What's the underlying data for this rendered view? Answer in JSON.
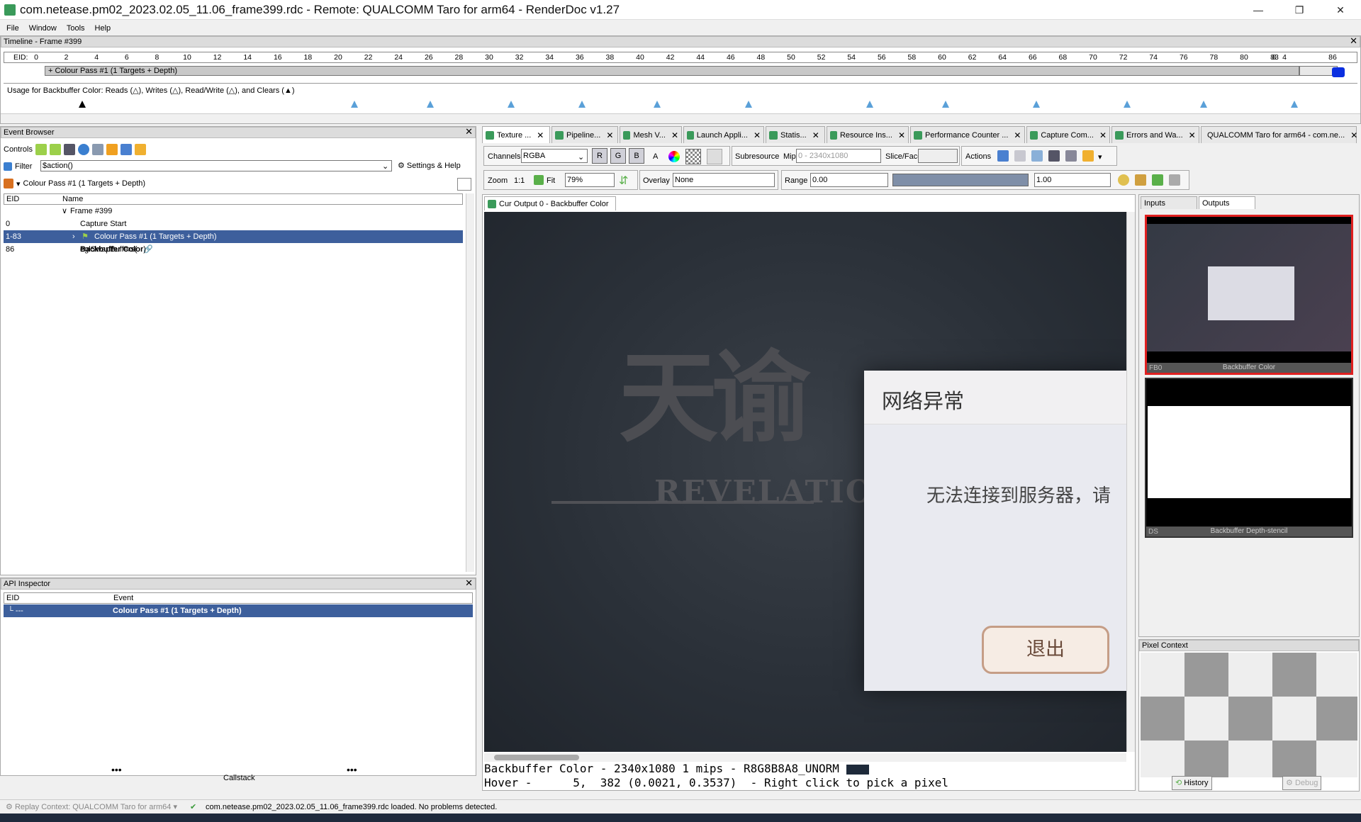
{
  "window": {
    "title": "com.netease.pm02_2023.02.05_11.06_frame399.rdc - Remote: QUALCOMM Taro for arm64 - RenderDoc v1.27",
    "minimize": "—",
    "maximize": "❐",
    "close": "✕"
  },
  "menu": [
    "File",
    "Window",
    "Tools",
    "Help"
  ],
  "timeline": {
    "title": "Timeline - Frame #399",
    "eid_label": "EID:",
    "ticks": [
      "0",
      "2",
      "4",
      "6",
      "8",
      "10",
      "12",
      "14",
      "16",
      "18",
      "20",
      "22",
      "24",
      "26",
      "28",
      "30",
      "32",
      "34",
      "36",
      "38",
      "40",
      "42",
      "44",
      "46",
      "48",
      "50",
      "52",
      "54",
      "56",
      "58",
      "60",
      "62",
      "64",
      "66",
      "68",
      "70",
      "72",
      "74",
      "76",
      "78",
      "80",
      "8",
      "83",
      "4",
      "86"
    ],
    "pass_label": "+ Colour Pass #1 (1 Targets + Depth)",
    "usage_label": "Usage for Backbuffer Color: Reads (△), Writes (△), Read/Write (△), and Clears (▲)"
  },
  "event_browser": {
    "title": "Event Browser",
    "controls_label": "Controls",
    "filter_label": "Filter",
    "filter_value": "$action()",
    "settings_label": "Settings & Help",
    "breadcrumb": "Colour Pass #1 (1 Targets + Depth)",
    "col_eid": "EID",
    "col_name": "Name",
    "rows": [
      {
        "eid": "",
        "name": "Frame #399"
      },
      {
        "eid": "0",
        "name": "Capture Start"
      },
      {
        "eid": "1-83",
        "name": "Colour Pass #1 (1 Targets + Depth)"
      },
      {
        "eid": "86",
        "name_prefix": "eglSwapBuffers(",
        "name_bold": "Backbuffer Color",
        "name_suffix": ")"
      }
    ]
  },
  "api_inspector": {
    "title": "API Inspector",
    "col_eid": "EID",
    "col_event": "Event",
    "row_eid": "└ ---",
    "row_event": "Colour Pass #1 (1 Targets + Depth)",
    "callstack": "Callstack",
    "dots": "•••"
  },
  "tabs": [
    "Texture ...",
    "Pipeline...",
    "Mesh V...",
    "Launch Appli...",
    "Statis...",
    "Resource Ins...",
    "Performance Counter ...",
    "Capture Com...",
    "Errors and Wa...",
    "QUALCOMM Taro for arm64 - com.ne..."
  ],
  "texture_toolbar": {
    "channels_label": "Channels",
    "channels_value": "RGBA",
    "ch_r": "R",
    "ch_g": "G",
    "ch_b": "B",
    "ch_a": "A",
    "subresource_label": "Subresource",
    "mip_label": "Mip",
    "mip_value": "0 - 2340x1080",
    "slice_label": "Slice/Face",
    "actions_label": "Actions",
    "zoom_label": "Zoom",
    "zoom_1to1": "1:1",
    "fit_label": "Fit",
    "zoom_value": "79%",
    "overlay_label": "Overlay",
    "overlay_value": "None",
    "range_label": "Range",
    "range_min": "0.00",
    "range_max": "1.00"
  },
  "viewer": {
    "tab_label": "Cur Output 0 - Backbuffer Color",
    "logo_cn": "天谕",
    "logo_en": "REVELATION",
    "dialog_title": "网络异常",
    "dialog_message": "无法连接到服务器，请",
    "dialog_button": "退出",
    "status_line1": "Backbuffer Color - 2340x1080 1 mips - R8G8B8A8_UNORM",
    "status_line2": "Hover -      5,  382 (0.0021, 0.3537)  - Right click to pick a pixel"
  },
  "right_panel": {
    "tab_inputs": "Inputs",
    "tab_outputs": "Outputs",
    "thumb1_code": "FB0",
    "thumb1_label": "Backbuffer Color",
    "thumb2_code": "DS",
    "thumb2_label": "Backbuffer Depth-stencil"
  },
  "pixel_context": {
    "title": "Pixel Context",
    "history": "History",
    "debug": "Debug"
  },
  "statusbar": {
    "replay_context": "Replay Context: QUALCOMM Taro for arm64",
    "message": "com.netease.pm02_2023.02.05_11.06_frame399.rdc loaded. No problems detected."
  },
  "colors": {
    "selection": "#3d5f9c",
    "accent_green": "#3a9a5a",
    "marker_blue": "#0b2fe0",
    "active_thumb_border": "#e02020"
  }
}
